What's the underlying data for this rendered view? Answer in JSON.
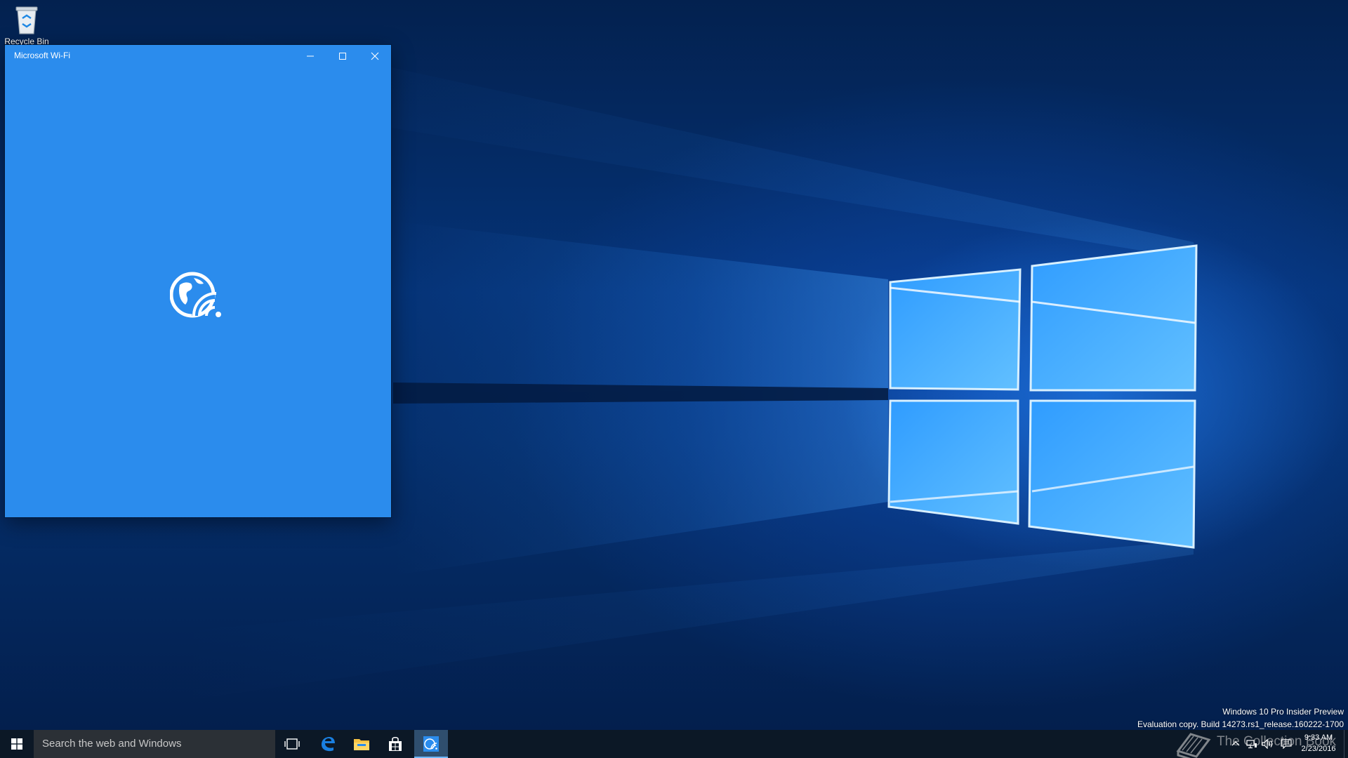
{
  "desktop": {
    "icons": [
      {
        "label": "Recycle Bin",
        "icon": "recycle-bin-icon"
      }
    ]
  },
  "window": {
    "title": "Microsoft Wi-Fi",
    "background_color": "#2b8ced",
    "controls": {
      "minimize": "minimize-icon",
      "maximize": "maximize-icon",
      "close": "close-icon"
    },
    "splash_icon": "globe-wifi-icon"
  },
  "watermark": {
    "line1": "Windows 10 Pro Insider Preview",
    "line2": "Evaluation copy. Build 14273.rs1_release.160222-1700"
  },
  "taskbar": {
    "start_icon": "windows-logo-icon",
    "search_placeholder": "Search the web and Windows",
    "pinned": [
      {
        "name": "Task View",
        "icon": "task-view-icon"
      },
      {
        "name": "Microsoft Edge",
        "icon": "edge-icon"
      },
      {
        "name": "File Explorer",
        "icon": "folder-icon"
      },
      {
        "name": "Store",
        "icon": "store-icon"
      },
      {
        "name": "Microsoft Wi-Fi",
        "icon": "globe-wifi-icon",
        "active": true
      }
    ],
    "tray": {
      "overlay_text": "The Collection Book",
      "icons": [
        "chevron-up-icon",
        "network-icon",
        "volume-icon",
        "action-center-icon"
      ],
      "time": "9:33 AM",
      "date": "2/23/2016"
    }
  },
  "colors": {
    "taskbar": "#0c1826",
    "search_box": "#2b3036",
    "accent": "#2b8ced"
  }
}
